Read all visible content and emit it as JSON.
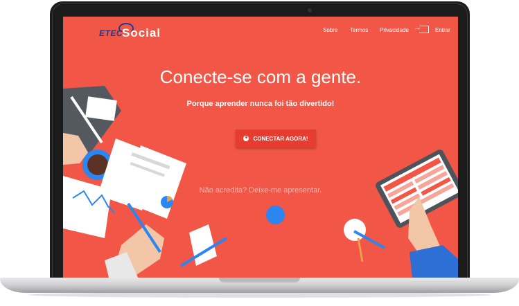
{
  "logo": {
    "part1": "ETEC",
    "part2": "Social"
  },
  "nav": {
    "about": "Sobre",
    "terms": "Termos",
    "privacy": "Privacidade",
    "login": "Entrar"
  },
  "hero": {
    "title": "Conecte-se com a gente.",
    "subtitle": "Porque aprender nunca foi tão divertido!",
    "cta": "CONECTAR AGORA!",
    "cta_icon": "user-circle-icon",
    "present": "Não acredita? Deixe-me apresentar."
  },
  "colors": {
    "background": "#f25646",
    "button": "#e73c30",
    "dot": "#2b86f2",
    "logo": "#1d3a8f"
  }
}
